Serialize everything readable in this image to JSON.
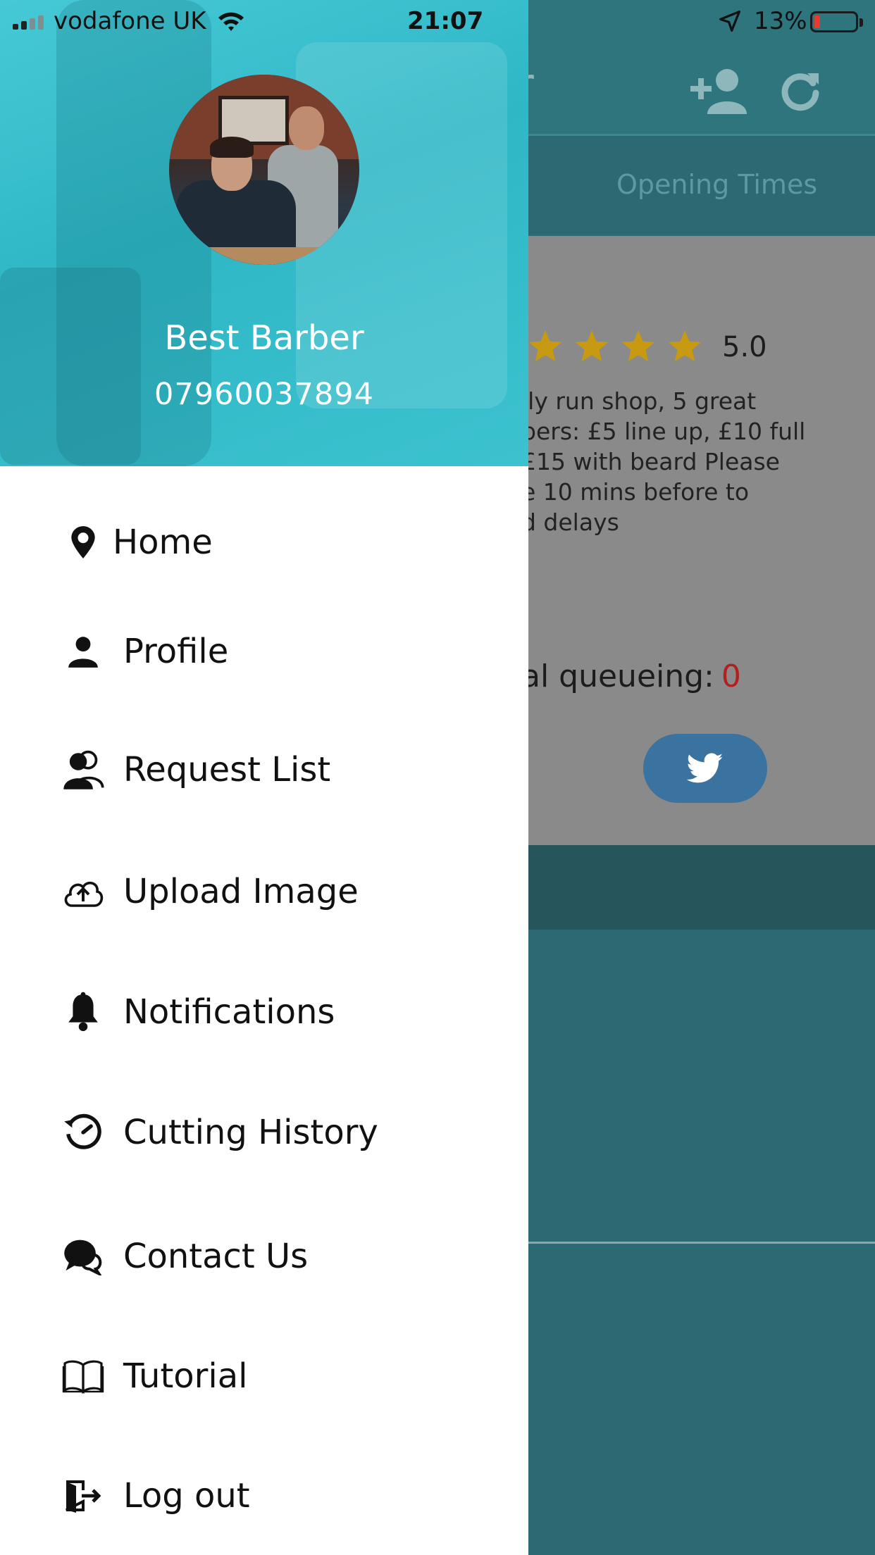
{
  "status_bar": {
    "carrier": "vodafone UK",
    "time": "21:07",
    "battery_percent": "13%"
  },
  "background": {
    "title_fragment": "er",
    "tab_label": "Opening Times",
    "rating": "5.0",
    "star_count": 4,
    "description": "ily run shop, 5 great\npers: £5 line up, £10 full\n£15 with beard   Please\ne 10 mins before to\nd delays",
    "queue_label": "al queueing:",
    "queue_count": "0",
    "icons": [
      "add-user-icon",
      "refresh-icon",
      "twitter-icon",
      "star-icon"
    ]
  },
  "drawer": {
    "shop_name": "Best Barber",
    "phone": "07960037894",
    "menu": [
      {
        "label": "Home",
        "icon": "map-pin-icon"
      },
      {
        "label": "Profile",
        "icon": "user-icon"
      },
      {
        "label": "Request List",
        "icon": "users-icon"
      },
      {
        "label": "Upload Image",
        "icon": "cloud-upload-icon"
      },
      {
        "label": "Notifications",
        "icon": "bell-icon"
      },
      {
        "label": "Cutting History",
        "icon": "history-icon"
      },
      {
        "label": "Contact Us",
        "icon": "chat-icon"
      },
      {
        "label": "Tutorial",
        "icon": "book-icon"
      },
      {
        "label": "Log out",
        "icon": "logout-icon"
      }
    ]
  },
  "colors": {
    "drawer_header": "#3cc2cf",
    "app_header": "#2f757d",
    "star": "#c79a12",
    "queue_count": "#b41e1e",
    "twitter_button": "#3a72a0"
  }
}
